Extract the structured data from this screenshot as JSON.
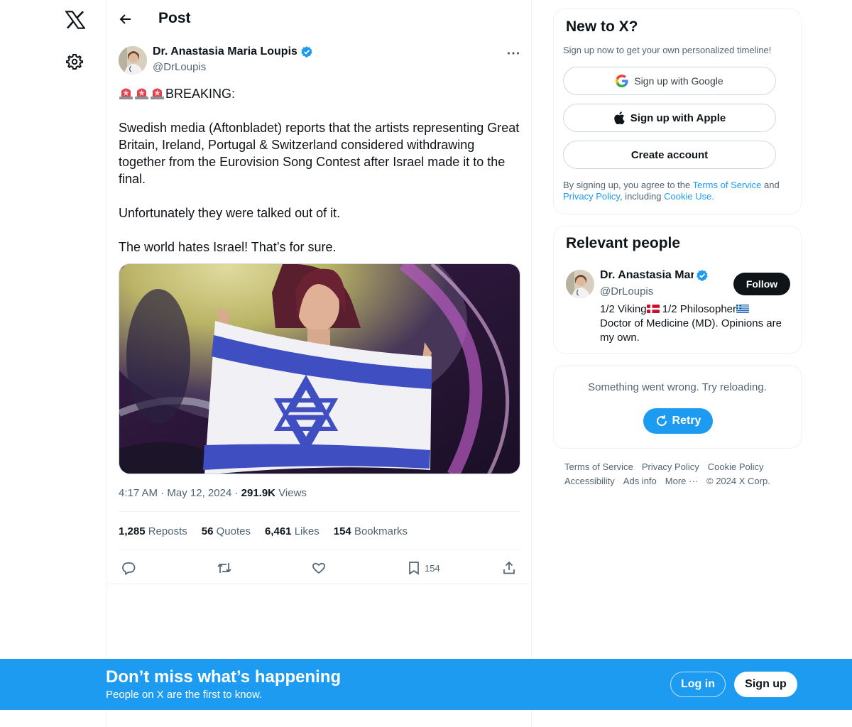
{
  "nav": {
    "logo_icon": "x-logo-icon",
    "settings_icon": "gear-icon"
  },
  "header": {
    "title": "Post",
    "back_icon": "arrow-left-icon"
  },
  "post": {
    "author_name": "Dr. Anastasia Maria Loupis",
    "author_handle": "@DrLoupis",
    "verified": true,
    "text": {
      "line1": "BREAKING:",
      "para2": "Swedish media (Aftonbladet) reports that the artists representing Great Britain, Ireland, Portugal & Switzerland considered withdrawing together from the Eurovision Song Contest after Israel made it to the final.",
      "para3": "Unfortunately they were talked out of it.",
      "para4": "The world hates Israel! That’s for sure."
    },
    "time": "4:17 AM",
    "date": "May 12, 2024",
    "views_count": "291.9K",
    "views_label": "Views",
    "stats": {
      "reposts_count": "1,285",
      "reposts_label": "Reposts",
      "quotes_count": "56",
      "quotes_label": "Quotes",
      "likes_count": "6,461",
      "likes_label": "Likes",
      "bookmarks_count": "154",
      "bookmarks_label": "Bookmarks"
    },
    "actions": {
      "bookmark_count": "154"
    }
  },
  "signup_card": {
    "title": "New to X?",
    "subtitle": "Sign up now to get your own personalized timeline!",
    "google_label": "Sign up with Google",
    "apple_label": "Sign up with Apple",
    "create_label": "Create account",
    "legal_prefix": "By signing up, you agree to the ",
    "terms_link": "Terms of Service",
    "legal_and": " and ",
    "privacy_link": "Privacy Policy",
    "legal_including": ", including ",
    "cookie_link": "Cookie Use."
  },
  "relevant_people": {
    "title": "Relevant people",
    "name": "Dr. Anastasia Maria Loupis",
    "handle": "@DrLoupis",
    "follow_label": "Follow",
    "bio_part1": "1/2 Viking",
    "bio_part2": " 1/2 Philosopher",
    "bio_part3": "Doctor of Medicine (MD). Opinions are my own."
  },
  "error_card": {
    "message": "Something went wrong. Try reloading.",
    "retry_label": "Retry"
  },
  "footer": {
    "links": [
      "Terms of Service",
      "Privacy Policy",
      "Cookie Policy",
      "Accessibility",
      "Ads info",
      "More ···"
    ],
    "copyright": "© 2024 X Corp."
  },
  "banner": {
    "title": "Don’t miss what’s happening",
    "subtitle": "People on X are the first to know.",
    "login_label": "Log in",
    "signup_label": "Sign up"
  },
  "colors": {
    "accent": "#1d9bf0",
    "text_primary": "#0f1419",
    "text_secondary": "#536471",
    "border": "#eff3f4"
  }
}
